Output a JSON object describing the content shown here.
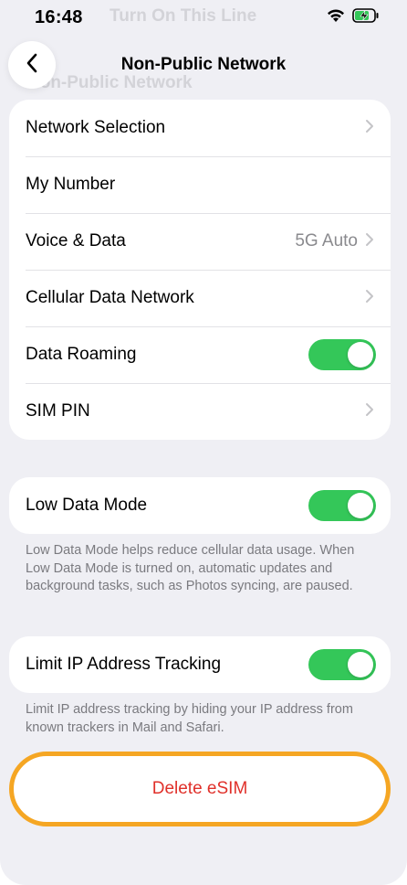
{
  "status_bar": {
    "time": "16:48",
    "ghost_header": "Turn On This Line"
  },
  "nav": {
    "title": "Non-Public Network",
    "ghost_title": "Non-Public Network"
  },
  "network_group": {
    "rows": [
      {
        "label": "Network Selection",
        "value": "",
        "accessory": "chevron"
      },
      {
        "label": "My Number",
        "value": "",
        "accessory": "none"
      },
      {
        "label": "Voice & Data",
        "value": "5G Auto",
        "accessory": "chevron"
      },
      {
        "label": "Cellular Data Network",
        "value": "",
        "accessory": "chevron"
      },
      {
        "label": "Data Roaming",
        "value": "",
        "accessory": "toggle",
        "on": true
      },
      {
        "label": "SIM PIN",
        "value": "",
        "accessory": "chevron"
      }
    ]
  },
  "low_data": {
    "label": "Low Data Mode",
    "on": true,
    "footnote": "Low Data Mode helps reduce cellular data usage. When Low Data Mode is turned on, automatic updates and background tasks, such as Photos syncing, are paused."
  },
  "limit_ip": {
    "label": "Limit IP Address Tracking",
    "on": true,
    "footnote": "Limit IP address tracking by hiding your IP address from known trackers in Mail and Safari."
  },
  "delete": {
    "label": "Delete eSIM"
  },
  "colors": {
    "background": "#efeff4",
    "toggle_on": "#34c759",
    "destructive": "#e0302a",
    "highlight_outline": "#f5a623"
  }
}
